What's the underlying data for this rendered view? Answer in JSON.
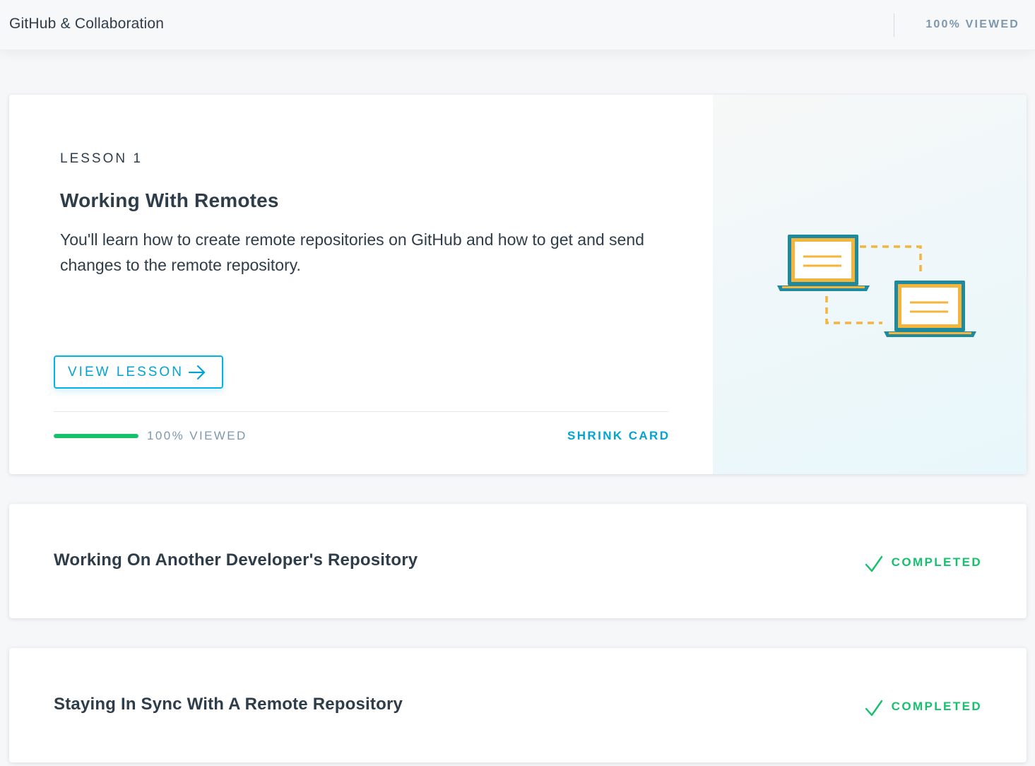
{
  "header": {
    "title": "GitHub & Collaboration",
    "progress_text": "100% VIEWED"
  },
  "lesson_card": {
    "number_label": "LESSON 1",
    "title": "Working With Remotes",
    "description": "You'll learn how to create remote repositories on GitHub and how to get and send changes to the remote repository.",
    "button_label": "VIEW LESSON",
    "progress_fraction": 1.0,
    "progress_text": "100% VIEWED",
    "shrink_label": "SHRINK CARD",
    "illustration_icon": "two-laptops-connected-icon"
  },
  "other_lessons": [
    {
      "title": "Working On Another Developer's Repository",
      "status": "COMPLETED"
    },
    {
      "title": "Staying In Sync With A Remote Repository",
      "status": "COMPLETED"
    }
  ],
  "colors": {
    "accent": "#02b3e4",
    "success": "#15c26b",
    "text": "#2e3d49",
    "muted": "#7d97ad",
    "illustration_teal": "#1d8aa0",
    "illustration_orange": "#f5b43a"
  }
}
